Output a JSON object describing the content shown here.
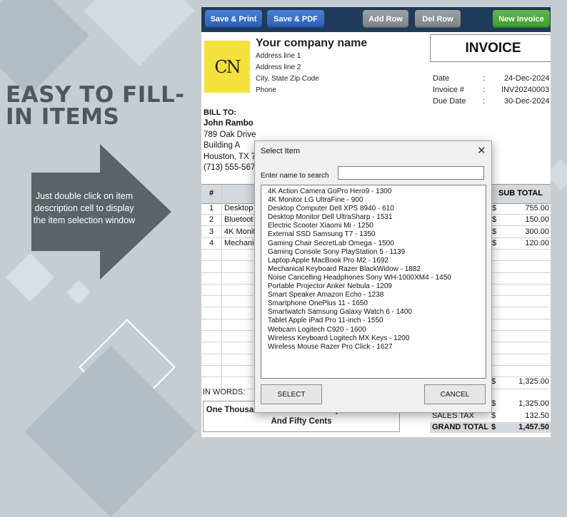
{
  "promo": {
    "headline": "EASY TO FILL-IN ITEMS",
    "arrow_text": "Just double click on item description cell to display the item selection window"
  },
  "toolbar": {
    "save_print": "Save & Print",
    "save_pdf": "Save & PDF",
    "add_row": "Add Row",
    "del_row": "Del Row",
    "new_invoice": "New Invoice"
  },
  "company": {
    "logo_text": "CN",
    "name": "Your company name",
    "address_line1": "Address line 1",
    "address_line2": "Address line 2",
    "city": "City, State Zip Code",
    "phone": "Phone"
  },
  "invoice": {
    "title": "INVOICE",
    "date_label": "Date",
    "date_value": "24-Dec-2024",
    "number_label": "Invoice #",
    "number_value": "INV20240003",
    "due_label": "Due Date",
    "due_value": "30-Dec-2024",
    "colon": ":"
  },
  "bill_to": {
    "label": "BILL TO:",
    "name": "John Rambo",
    "street": "789 Oak Drive",
    "building": "Building A",
    "city": "Houston, TX 77",
    "phone": "(713) 555-5678"
  },
  "table": {
    "col_num": "#",
    "col_subtotal": "SUB TOTAL",
    "rows": [
      {
        "num": "1",
        "desc": "Desktop",
        "cur": "$",
        "subtotal": "755.00"
      },
      {
        "num": "2",
        "desc": "Bluetoot",
        "cur": "$",
        "subtotal": "150.00"
      },
      {
        "num": "3",
        "desc": "4K Monit",
        "cur": "$",
        "subtotal": "300.00"
      },
      {
        "num": "4",
        "desc": "Mechani",
        "cur": "$",
        "subtotal": "120.00"
      }
    ]
  },
  "totals": {
    "in_words_label": "IN WORDS:",
    "in_words": "One Thousand Four Hundred Fifty Seven Dollars And Fifty  Cents",
    "subtotal_cur": "$",
    "subtotal": "1,325.00",
    "taxable_cur": "$",
    "taxable": "1,325.00",
    "sales_tax_label": "SALES TAX",
    "sales_tax_cur": "$",
    "sales_tax": "132.50",
    "grand_total_label": "GRAND TOTAL",
    "grand_total_cur": "$",
    "grand_total": "1,457.50"
  },
  "dialog": {
    "title": "Select Item",
    "close": "✕",
    "search_label": "Enter name to search",
    "search_value": "",
    "items": [
      "4K Action Camera GoPro Hero9 - 1300",
      "4K Monitor LG UltraFine - 900",
      "Desktop Computer Dell XPS 8940 - 610",
      "Desktop Monitor Dell UltraSharp - 1531",
      "Electric Scooter Xiaomi Mi - 1250",
      "External SSD Samsung T7 - 1350",
      "Gaming Chair SecretLab Omega - 1500",
      "Gaming Console Sony PlayStation 5 - 1139",
      "Laptop Apple MacBook Pro M2 - 1692",
      "Mechanical Keyboard Razer BlackWidow - 1882",
      "Noise Cancelling Headphones Sony WH-1000XM4 - 1450",
      "Portable Projector Anker Nebula - 1209",
      "Smart Speaker Amazon Echo - 1238",
      "Smartphone OnePlus 11 - 1650",
      "Smartwatch Samsung Galaxy Watch 6 - 1400",
      "Tablet Apple iPad Pro 11-inch - 1550",
      "Webcam Logitech C920 - 1600",
      "Wireless Keyboard Logitech MX Keys - 1200",
      "Wireless Mouse Razer Pro Click - 1627"
    ],
    "select_label": "SELECT",
    "cancel_label": "CANCEL"
  }
}
